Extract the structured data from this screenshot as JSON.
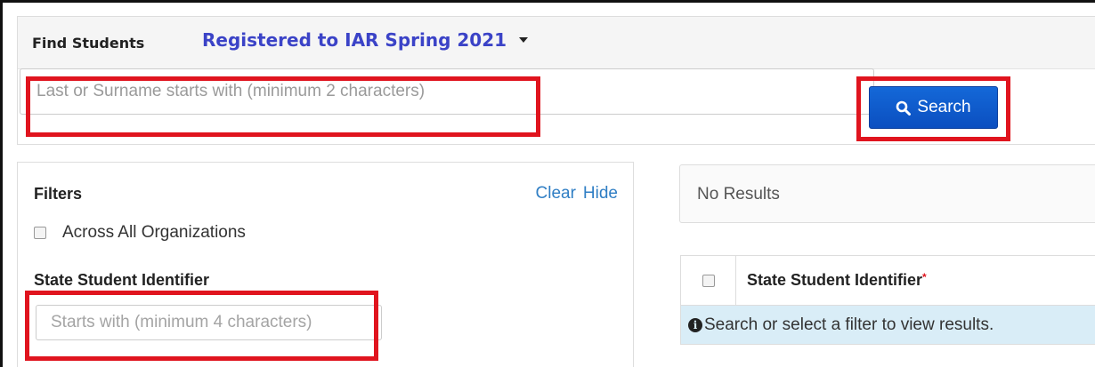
{
  "header": {
    "find_label": "Find Students",
    "registration_dropdown": "Registered to IAR Spring 2021"
  },
  "search": {
    "placeholder": "Last or Surname starts with (minimum 2 characters)",
    "button_label": "Search",
    "button_icon": "search-icon"
  },
  "filters": {
    "title": "Filters",
    "clear_label": "Clear",
    "hide_label": "Hide",
    "across_orgs_label": "Across All Organizations",
    "across_orgs_checked": false,
    "ssi_title": "State Student Identifier",
    "ssi_placeholder": "Starts with (minimum 4 characters)"
  },
  "results": {
    "status": "No Results",
    "table_header": "State Student Identifier",
    "required_marker": "*",
    "info_message": "Search or select a filter to view results.",
    "info_icon": "info-icon"
  },
  "colors": {
    "accent": "#3b43c7",
    "button": "#0b4fc0",
    "highlight": "#e0141e",
    "info_bg": "#d9edf7",
    "link": "#2f7ec4"
  }
}
